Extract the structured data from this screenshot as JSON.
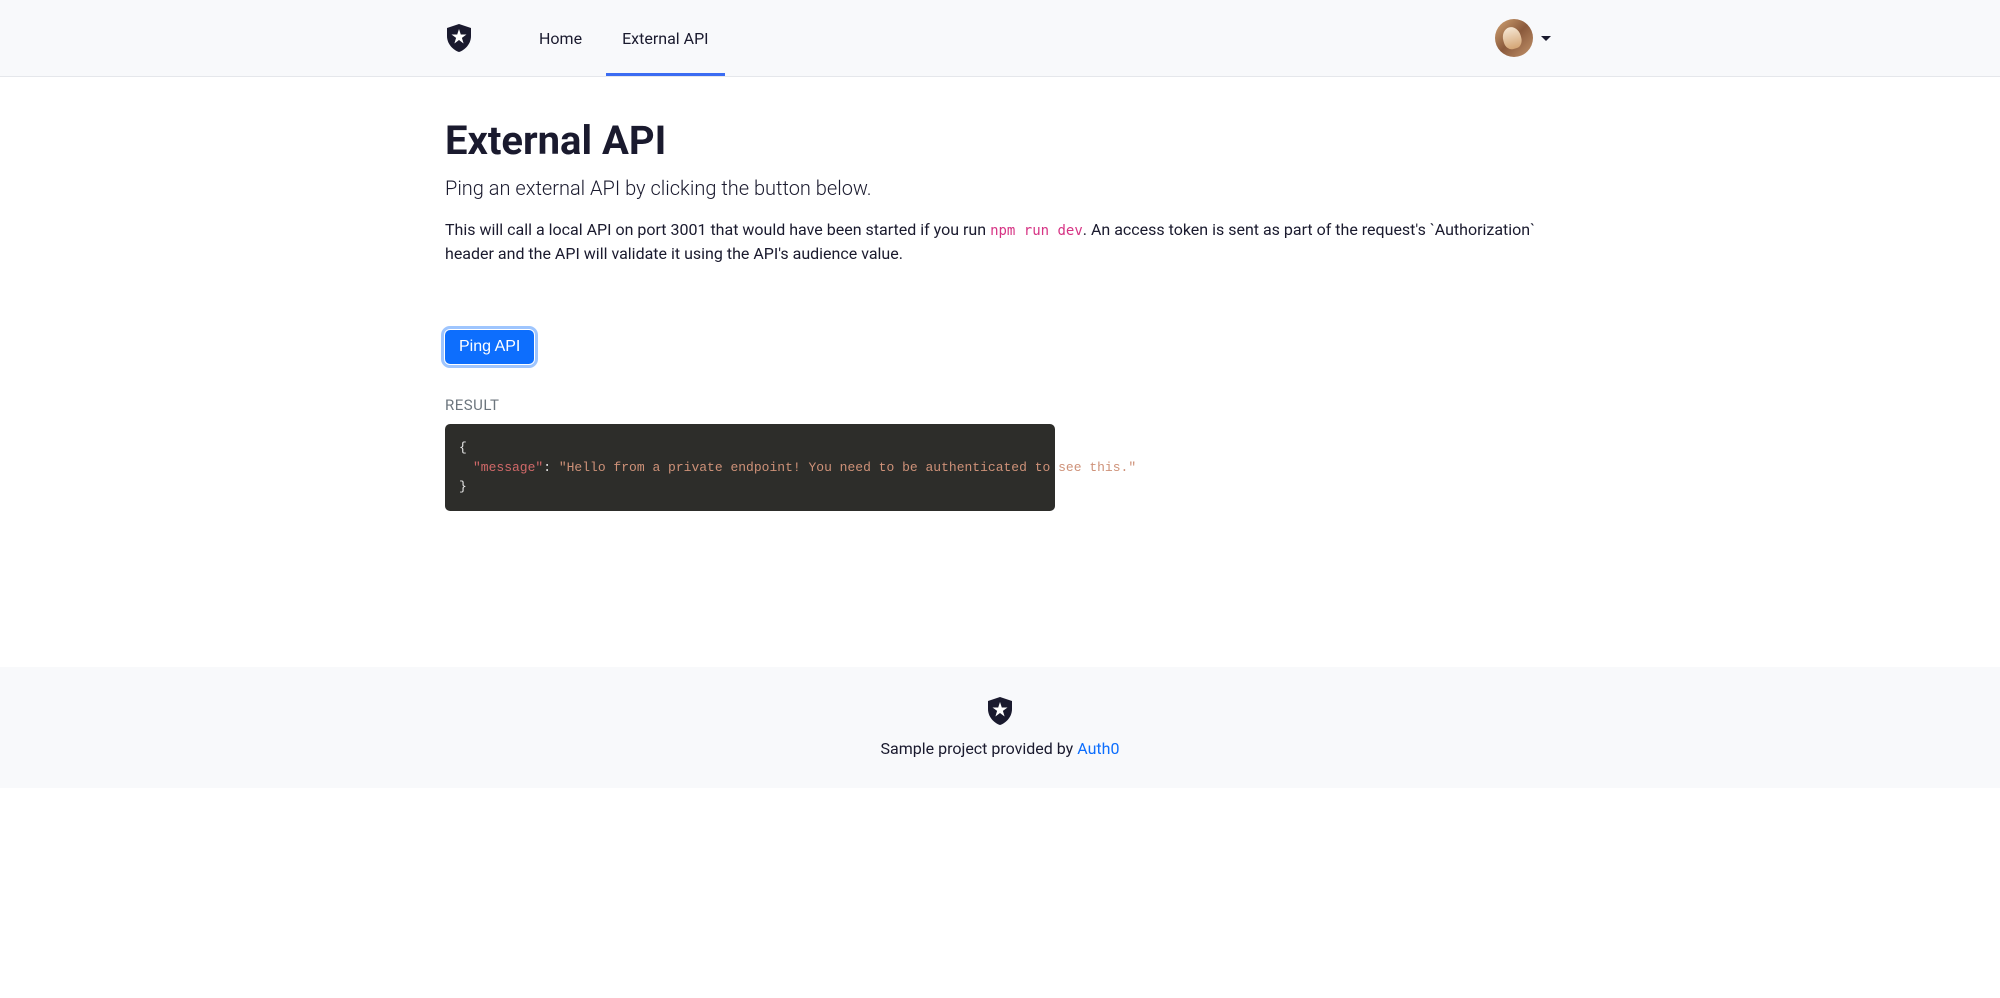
{
  "nav": {
    "home_label": "Home",
    "external_api_label": "External API"
  },
  "page": {
    "title": "External API",
    "lead": "Ping an external API by clicking the button below.",
    "desc_before_code": "This will call a local API on port 3001 that would have been started if you run ",
    "desc_code": "npm run dev",
    "desc_after_code": ". An access token is sent as part of the request's `Authorization` header and the API will validate it using the API's audience value.",
    "ping_button_label": "Ping API",
    "result_label": "RESULT"
  },
  "result": {
    "open_brace": "{",
    "key_quoted": "\"message\"",
    "colon_space": ": ",
    "value_quoted": "\"Hello from a private endpoint! You need to be authenticated to see this.\"",
    "close_brace": "}"
  },
  "footer": {
    "text_prefix": "Sample project provided by ",
    "link_label": "Auth0"
  }
}
